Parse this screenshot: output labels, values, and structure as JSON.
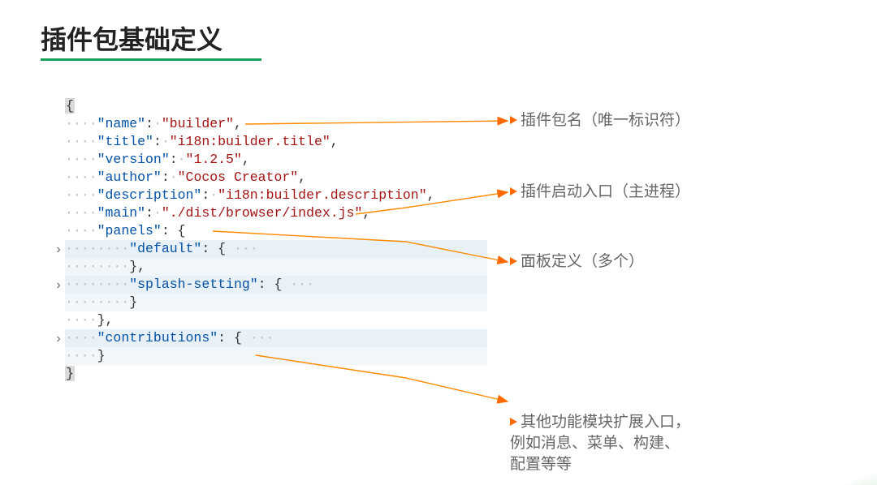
{
  "title": "插件包基础定义",
  "code": {
    "name_key": "\"name\"",
    "name_val": "\"builder\"",
    "title_key": "\"title\"",
    "title_val": "\"i18n:builder.title\"",
    "version_key": "\"version\"",
    "version_val": "\"1.2.5\"",
    "author_key": "\"author\"",
    "author_val": "\"Cocos Creator\"",
    "desc_key": "\"description\"",
    "desc_val": "\"i18n:builder.description\"",
    "main_key": "\"main\"",
    "main_val": "\"./dist/browser/index.js\"",
    "panels_key": "\"panels\"",
    "default_key": "\"default\"",
    "splash_key": "\"splash-setting\"",
    "contrib_key": "\"contributions\"",
    "open_brace": "{",
    "close_brace": "}",
    "colon_open": ": {",
    "comma": ",",
    "colon": ":",
    "space": " "
  },
  "annotations": {
    "a1": "插件包名（唯一标识符）",
    "a2": "插件启动入口（主进程）",
    "a3": "面板定义（多个）",
    "a4": "其他功能模块扩展入口，\n例如消息、菜单、构建、\n配置等等"
  }
}
